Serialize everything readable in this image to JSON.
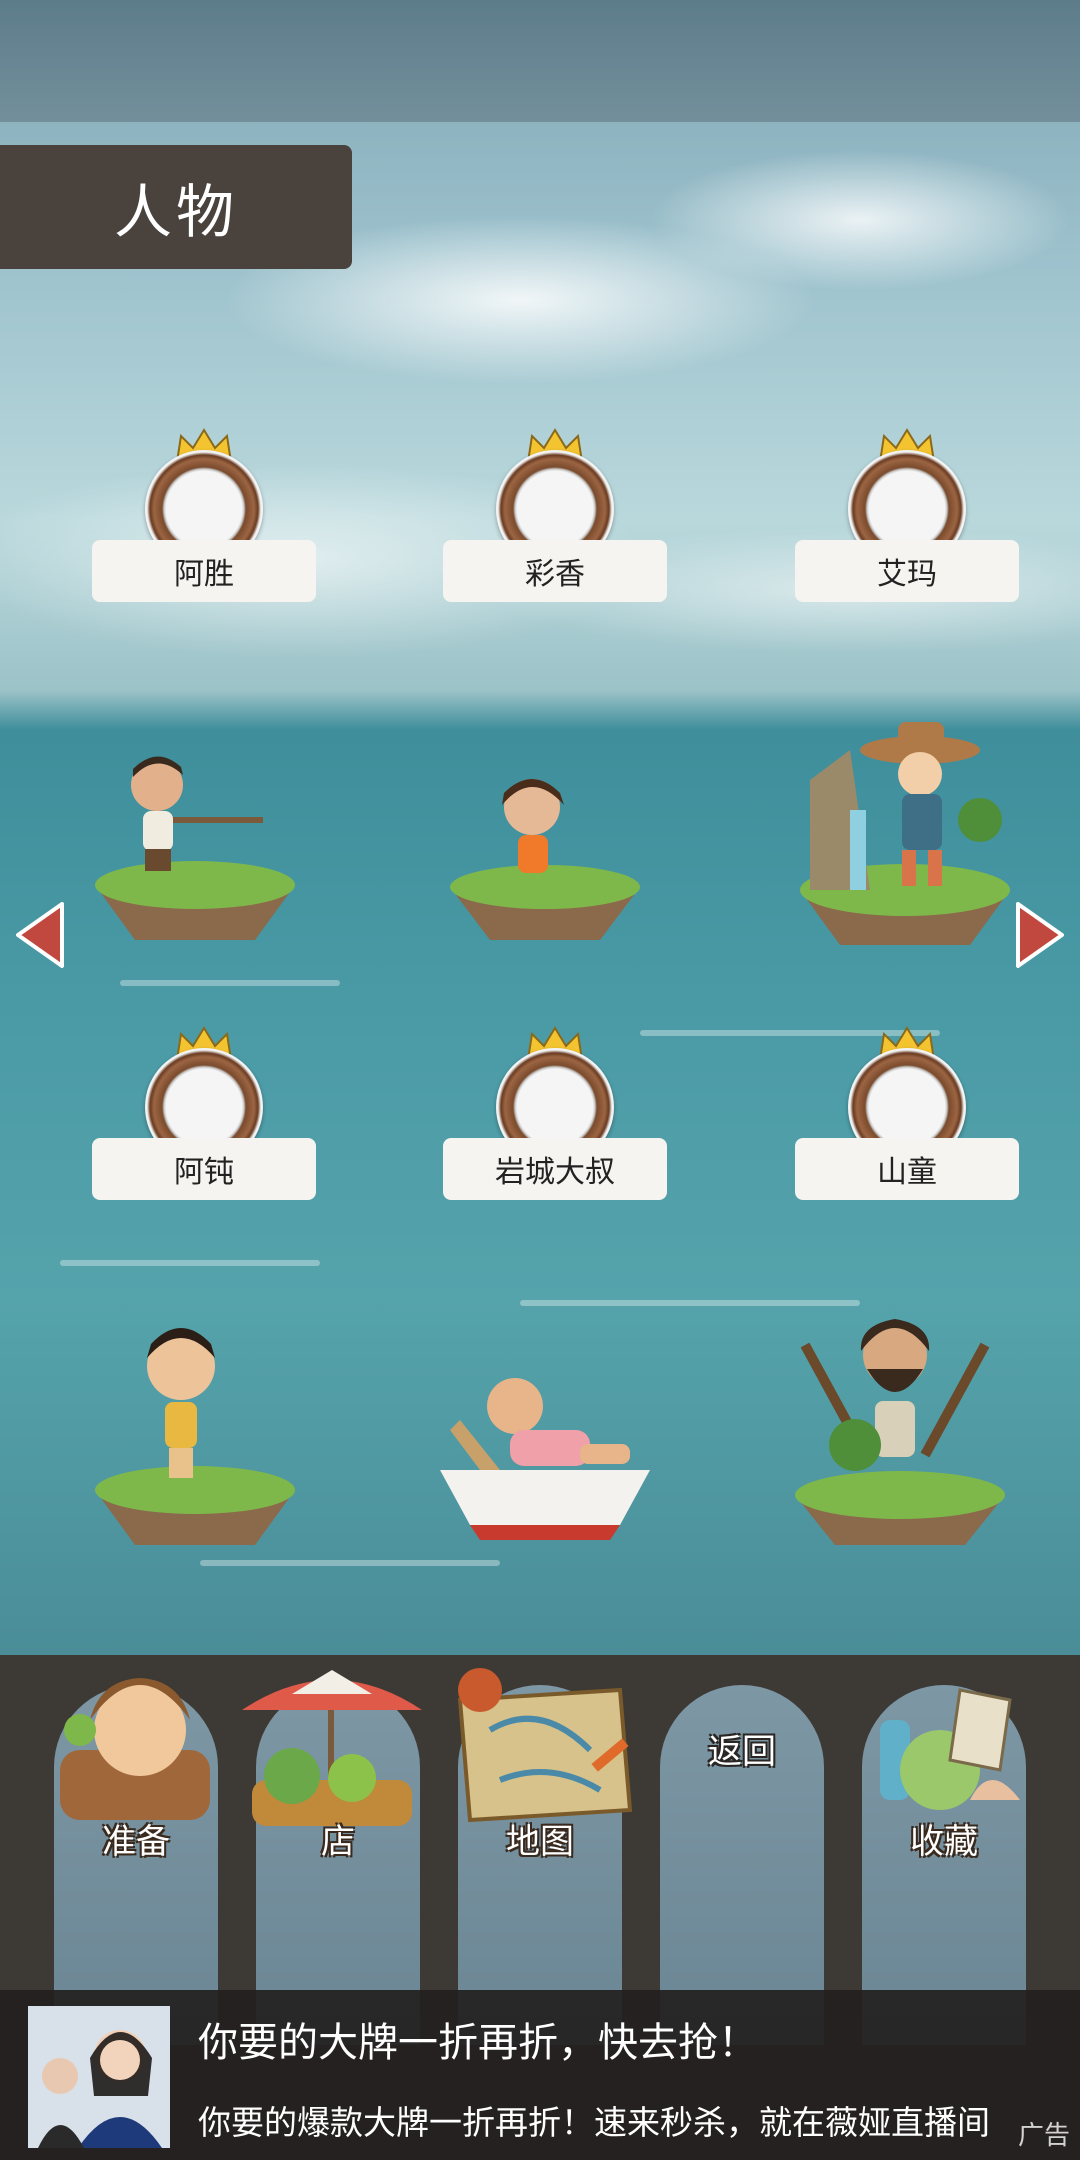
{
  "header": {
    "title": "人物"
  },
  "characters": [
    {
      "name": "阿胜"
    },
    {
      "name": "彩香"
    },
    {
      "name": "艾玛"
    },
    {
      "name": "阿钝"
    },
    {
      "name": "岩城大叔"
    },
    {
      "name": "山童"
    }
  ],
  "navigation": {
    "prev_icon": "left-arrow-icon",
    "next_icon": "right-arrow-icon"
  },
  "bottom_nav": {
    "prepare_label": "准备",
    "shop_label": "店",
    "map_label": "地图",
    "back_label": "返回",
    "collection_label": "收藏"
  },
  "ad": {
    "title": "你要的大牌一折再折，快去抢！",
    "subtitle": "你要的爆款大牌一折再折！速来秒杀，就在薇娅直播间",
    "tag": "广告"
  },
  "colors": {
    "header_bg": "#4a423d",
    "label_bg": "#f5f4f0",
    "arrow": "#c0483e",
    "nav_bg": "#3d3935",
    "nav_button": "#7d97a5"
  }
}
